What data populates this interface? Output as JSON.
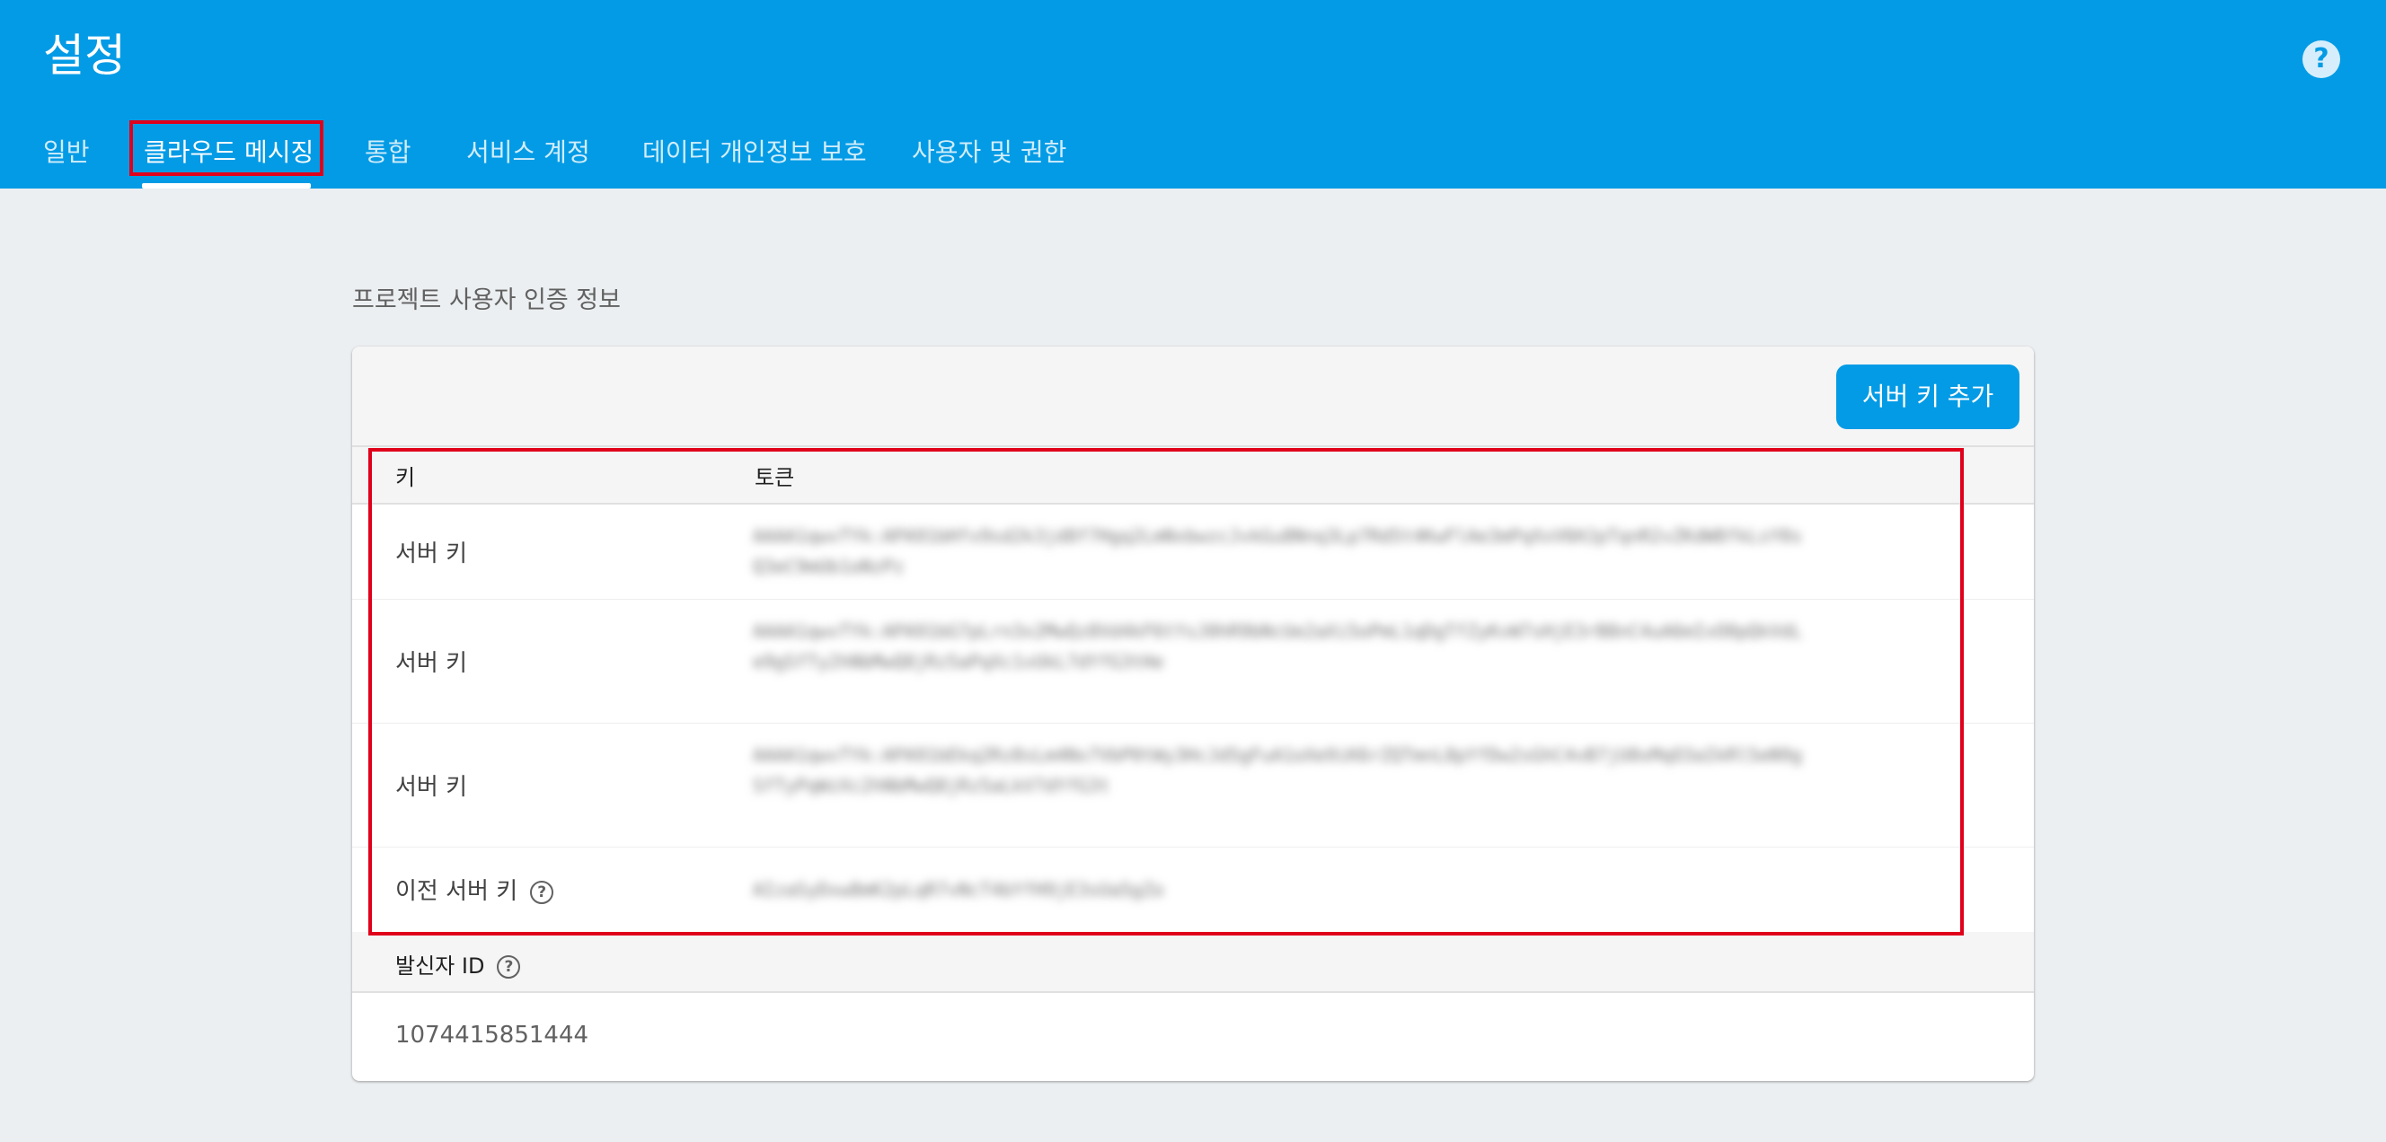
{
  "header": {
    "title": "설정",
    "help_icon": "?"
  },
  "tabs": [
    {
      "label": "일반",
      "active": false
    },
    {
      "label": "클라우드 메시징",
      "active": true
    },
    {
      "label": "통합",
      "active": false
    },
    {
      "label": "서비스 계정",
      "active": false
    },
    {
      "label": "데이터 개인정보 보호",
      "active": false
    },
    {
      "label": "사용자 및 권한",
      "active": false
    }
  ],
  "credentials": {
    "section_title": "프로젝트 사용자 인증 정보",
    "add_button_label": "서버 키 추가",
    "columns": {
      "key": "키",
      "token": "토큰"
    },
    "rows": [
      {
        "key": "서버 키",
        "token": "AAAA1qwvTYk:APA91bHfx9sd2k3jd8f7Hgq2LmNxbwzcJvkGu8Nnq3Lp7Rd5t4KwFlAe3mPqXxV6HJpTqnR2vZKdW8fkLsY0sQ3eC9mUb1oNzPz"
      },
      {
        "key": "서버 키",
        "token": "AAAA1qwvTYk:APA91bG7pLrn3x2MwQz8Vd4kF6tYsJ0hR9bNcUe2aXi5oPmL1qDgTfZyKvW7sHjE3rB8nC4uA6mIxO0pQkVdLe9gSfTy2hNbMwQ8jRz5aPqXc1vUkL7dYfG3tHe"
      },
      {
        "key": "서버 키",
        "token": "AAAA1qwvTYk:APA91bEkq2Rz8sLm4Nx7VbP0tWy3HcJd5gFuA1oXe9iK6rZQTmnL8pYfDw2sGhC4vB7jU0xMqO3aIkRl5eN9gSfTyPqWzXc2hNbMwQ8jRz5aLkV7dYfG3t"
      },
      {
        "key": "이전 서버 키",
        "has_help": true,
        "token": "AIzaSyDxw8mK2pLqR7vNcT4bYfH9jE3sUa5gZo"
      }
    ]
  },
  "sender": {
    "label": "발신자 ID",
    "value": "1074415851444"
  },
  "icons": {
    "help": "help-icon",
    "question": "question-circle-icon"
  },
  "colors": {
    "header_bg": "#039be5",
    "page_bg": "#eceff1",
    "highlight": "#e0001b"
  }
}
